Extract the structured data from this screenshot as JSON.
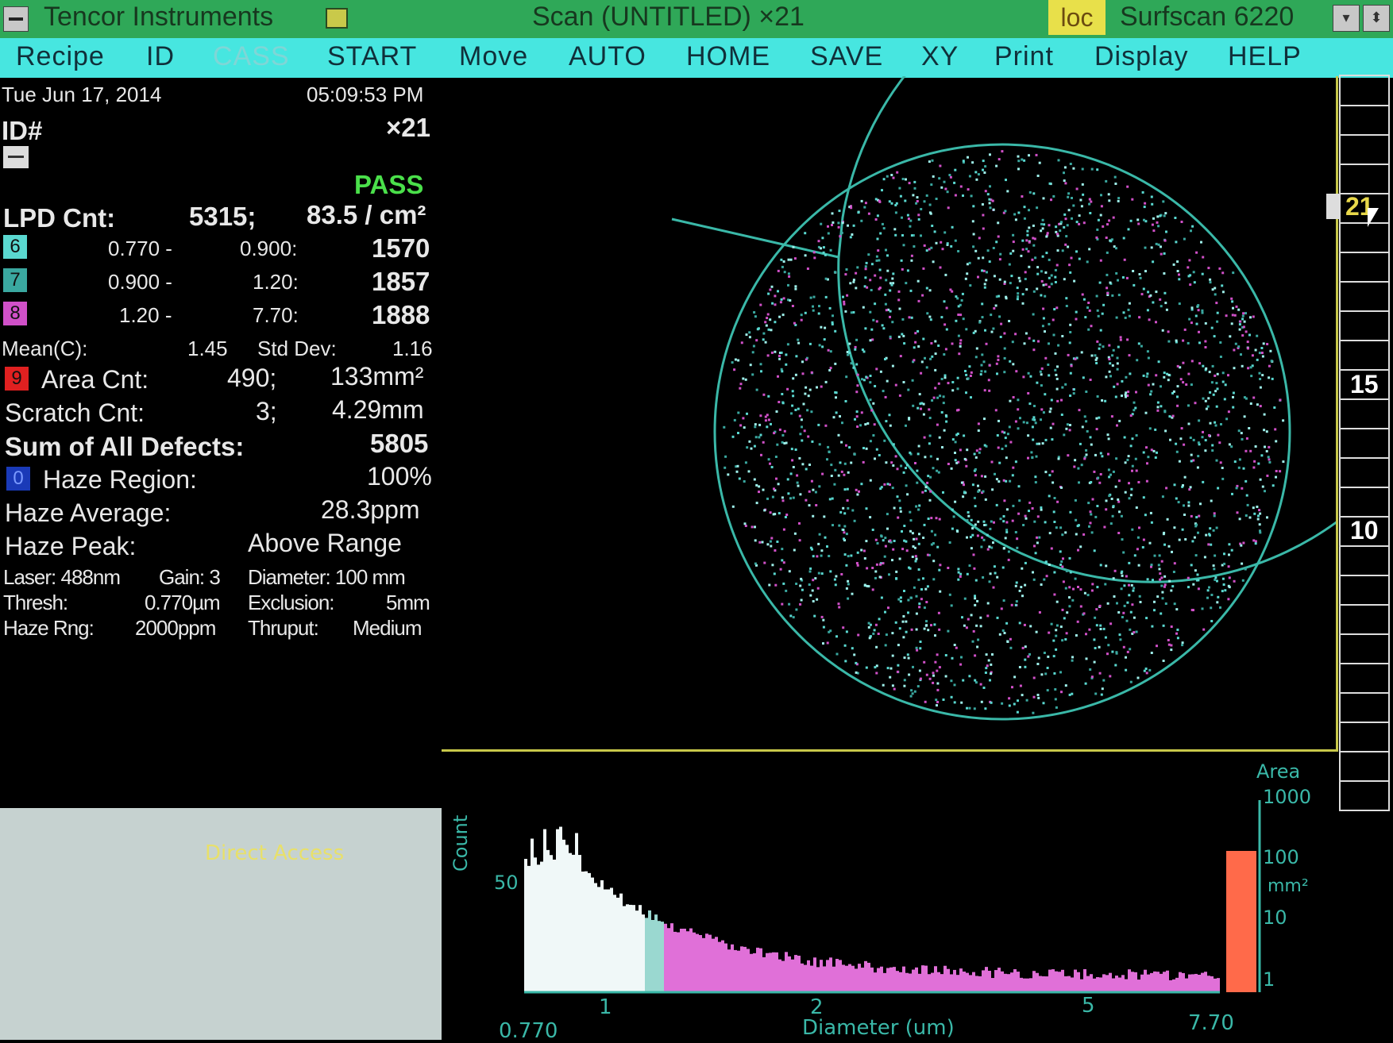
{
  "titlebar": {
    "app_title": "Tencor Instruments",
    "scan_title": "Scan (UNTITLED)  ×21",
    "loc": "loc",
    "model": "Surfscan 6220"
  },
  "menu": [
    "Recipe",
    "ID",
    "CASS",
    "START",
    "Move",
    "AUTO",
    "HOME",
    "SAVE",
    "XY",
    "Print",
    "Display",
    "HELP"
  ],
  "info": {
    "date": "Tue  Jun 17, 2014",
    "time": "05:09:53 PM",
    "id_label": "ID#",
    "id_value": "×21",
    "status": "PASS",
    "lpd_label": "LPD Cnt:",
    "lpd_count": "5315;",
    "lpd_density": "83.5 / cm²",
    "bins": [
      {
        "chip": "6",
        "color": "#5ad8d0",
        "from": "0.770 -",
        "to": "0.900:",
        "count": "1570"
      },
      {
        "chip": "7",
        "color": "#3aa8a0",
        "from": "0.900 -",
        "to": "1.20:",
        "count": "1857"
      },
      {
        "chip": "8",
        "color": "#d050c8",
        "from": "1.20 -",
        "to": "7.70:",
        "count": "1888"
      }
    ],
    "mean_label": "Mean(C):",
    "mean_value": "1.45",
    "std_label": "Std Dev:",
    "std_value": "1.16",
    "area_chip": "9",
    "area_label": "Area Cnt:",
    "area_count": "490;",
    "area_value": "133mm²",
    "scratch_label": "Scratch Cnt:",
    "scratch_count": "3;",
    "scratch_value": "4.29mm",
    "sum_label": "Sum of All Defects:",
    "sum_value": "5805",
    "haze_chip": "0",
    "haze_region_label": "Haze Region:",
    "haze_region_value": "100%",
    "haze_avg_label": "Haze Average:",
    "haze_avg_value": "28.3ppm",
    "haze_peak_label": "Haze Peak:",
    "haze_peak_value": "Above Range",
    "laser": "Laser: 488nm",
    "gain": "Gain: 3",
    "diameter": "Diameter: 100 mm",
    "thresh_label": "Thresh:",
    "thresh_value": "0.770µm",
    "exclusion_label": "Exclusion:",
    "exclusion_value": "5mm",
    "haze_rng_label": "Haze Rng:",
    "haze_rng_value": "2000ppm",
    "thruput_label": "Thruput:",
    "thruput_value": "Medium"
  },
  "direct_access": "Direct Access",
  "scale": {
    "current": "21",
    "mark_15": "15",
    "mark_10": "10"
  },
  "histogram": {
    "ylabel": "Count",
    "ytick": "50",
    "xlabel": "Diameter (um)",
    "xmin": "0.770",
    "xmax": "7.70",
    "xticks": [
      "1",
      "2",
      "5"
    ],
    "area_title": "Area",
    "area_ticks": [
      "1000",
      "100",
      "10",
      "1"
    ],
    "area_unit": "mm²",
    "area_bar_value": 100
  }
}
